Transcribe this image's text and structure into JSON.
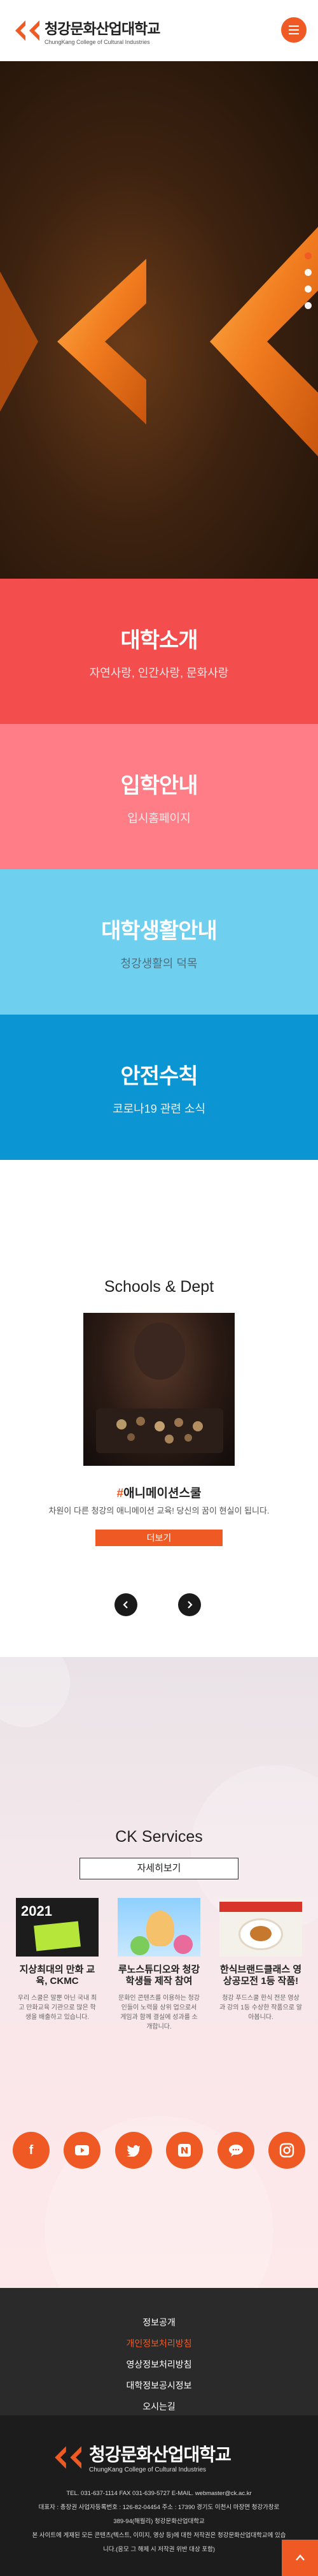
{
  "header": {
    "logo_ko": "청강문화산업대학교",
    "logo_en": "ChungKang College of Cultural Industries",
    "menu_icon": "hamburger-icon"
  },
  "hero": {
    "slide_count": 4,
    "active_slide": 1
  },
  "panels": [
    {
      "title": "대학소개",
      "subtitle": "자연사랑, 인간사랑, 문화사랑"
    },
    {
      "title": "입학안내",
      "subtitle": "입시홈페이지"
    },
    {
      "title": "대학생활안내",
      "subtitle": "청강생활의 덕목"
    },
    {
      "title": "안전수칙",
      "subtitle": "코로나19 관련 소식"
    }
  ],
  "schools": {
    "title": "Schools & Dept",
    "caption_hash": "#",
    "caption": "애니메이션스쿨",
    "description": "차원이 다른 청강의 애니메이션 교육! 당신의 꿈이 현실이 됩니다.",
    "more_label": "더보기",
    "prev_icon": "chevron-left-icon",
    "next_icon": "chevron-right-icon"
  },
  "services": {
    "title": "CK Services",
    "more_label": "자세히보기",
    "cards": [
      {
        "title": "지상최대의 만화 교육, CKMC",
        "desc": "우리 스쿨은 말뿐 아닌 국내 최고 만화교육 기관으로 많은 학생을 배출하고 있습니다."
      },
      {
        "title": "루노스튜디오와 청강 학생들 제작 참여",
        "desc": "문화인 콘텐츠를 이용하는 청강인들이 노력을 상위 업으로서 게임과 함께 결실에 성과를 소개합니다."
      },
      {
        "title": "한식브랜드클래스 영상공모전 1등 작품!",
        "desc": "청강 푸드스쿨 한식 전문 영상과 강의 1등 수상한 작품으로 알아봅니다."
      }
    ],
    "card1_badge": "2021",
    "social": [
      "facebook-icon",
      "youtube-icon",
      "twitter-icon",
      "naver-blog-icon",
      "kakao-icon",
      "instagram-icon"
    ]
  },
  "footer": {
    "links": [
      "정보공개",
      "개인정보처리방침",
      "영상정보처리방침",
      "대학정보공시정보",
      "오시는길"
    ],
    "highlight_index": 1,
    "logo_ko": "청강문화산업대학교",
    "logo_en": "ChungKang College of Cultural Industries",
    "info_lines": [
      "TEL. 031-637-1114   FAX 031-639-5727   E-MAIL. webmaster@ck.ac.kr",
      "대표자 : 총장권 사업자등록번호 : 126-82-04454   주소 : 17390 경기도 이천시 마장면 청강가창로",
      "389-94(해월리) 청강문화산업대학교",
      "본 사이트에 게재된 모든 콘텐츠(텍스트, 이미지, 영상 등)에 대한 저작권은 청강문화산업대학교에 있습",
      "니다.(응모 그 해제 시 저작권 위반 대상 포함)"
    ],
    "top_icon": "arrow-up-icon"
  },
  "colors": {
    "accent": "#ef5a24",
    "panel1": "#f34d4d",
    "panel2": "#ff7d86",
    "panel3": "#6fcfee",
    "panel4": "#0b96d3"
  }
}
